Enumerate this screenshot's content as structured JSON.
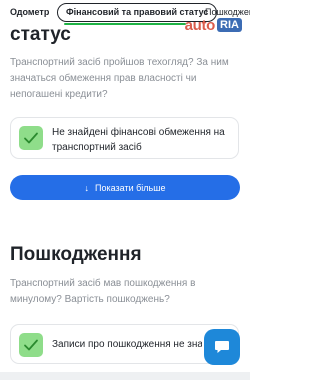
{
  "tabs": {
    "items": [
      "Одометр",
      "Фінансовий та правовий статус",
      "Пошкодження"
    ],
    "active_index": 1
  },
  "logo": {
    "auto": "auto",
    "ria": "RIA"
  },
  "financial": {
    "title": "статус",
    "description": "Транспортний засіб пройшов техогляд? За ним значаться обмеження прав власності чи непогашені кредити?",
    "result": "Не знайдені фінансові обмеження на транспортний засіб",
    "more_label": "Показати більше"
  },
  "damage": {
    "title": "Пошкодження",
    "description": "Транспортний засіб мав пошкодження в минулому? Вартість пошкоджень?",
    "result": "Записи про пошкодження не знайдені"
  },
  "colors": {
    "accent": "#256ee7",
    "check_bg": "#8fdd8a",
    "progress": "#1fb245",
    "chat": "#1e88d9"
  },
  "icons": [
    "check-icon",
    "arrow-down-icon",
    "chat-icon"
  ]
}
